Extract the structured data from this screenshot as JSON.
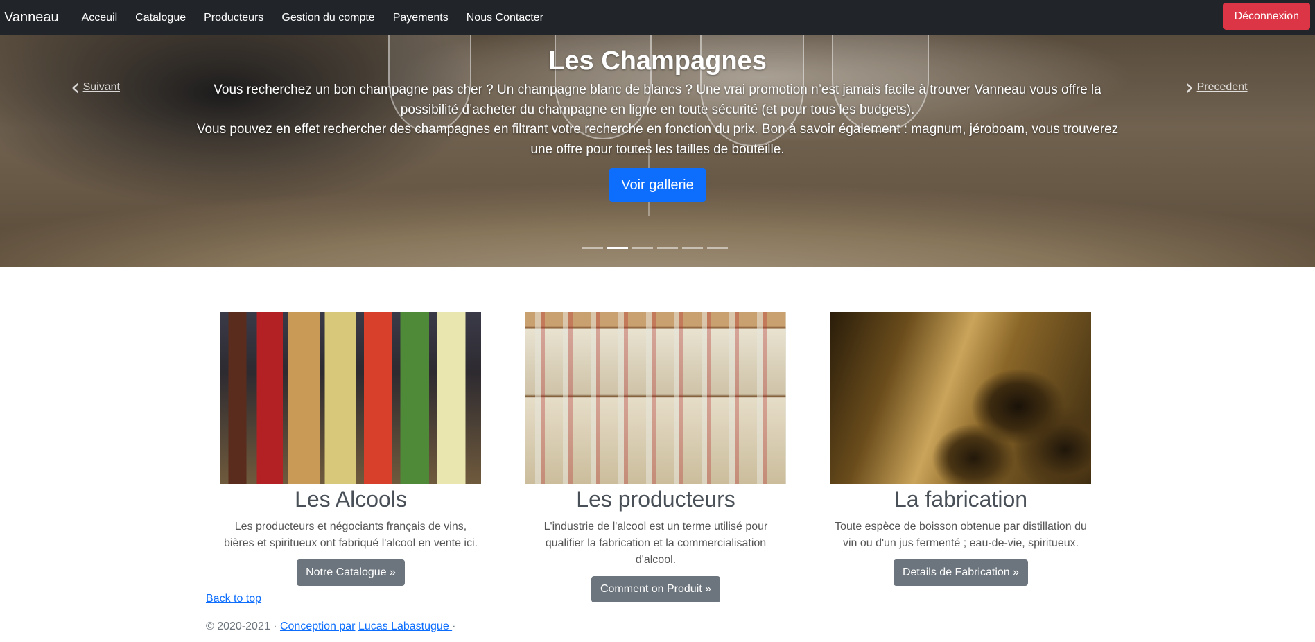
{
  "navbar": {
    "brand": "Vanneau",
    "links": [
      "Acceuil",
      "Catalogue",
      "Producteurs",
      "Gestion du compte",
      "Payements",
      "Nous Contacter"
    ],
    "logout": "Déconnexion"
  },
  "hero": {
    "title": "Les Champagnes",
    "paragraph1": "Vous recherchez un bon champagne pas cher ? Un champagne blanc de blancs ? Une vrai promotion n’est jamais facile à trouver Vanneau vous offre la possibilité d’acheter du champagne en ligne en toute sécurité (et pour tous les budgets).",
    "paragraph2": "Vous pouvez en effet rechercher des champagnes en filtrant votre recherche en fonction du prix. Bon à savoir également : magnum, jéroboam, vous trouverez une offre pour toutes les tailles de bouteille.",
    "button": "Voir gallerie",
    "prev_label": "Suivant",
    "next_label": "Precedent",
    "slide_count": 6,
    "active_slide": 2
  },
  "columns": [
    {
      "title": "Les Alcools",
      "text": "Les producteurs et négociants français de vins, bières et spiritueux ont fabriqué l'alcool en vente ici.",
      "button": "Notre Catalogue »"
    },
    {
      "title": "Les producteurs",
      "text": "L'industrie de l'alcool est un terme utilisé pour qualifier la fabrication et la commercialisation d'alcool.",
      "button": "Comment on Produit »"
    },
    {
      "title": "La fabrication",
      "text": "Toute espèce de boisson obtenue par distillation du vin ou d'un jus fermenté ; eau-de-vie, spiritueux.",
      "button": "Details de Fabrication »"
    }
  ],
  "footer": {
    "back_to_top": "Back to top",
    "copyright": "© 2020-2021 · ",
    "link1": "Conception par",
    "link2": "Lucas Labastugue ",
    "trailing": "·"
  },
  "colors": {
    "navbar_bg": "#212529",
    "danger": "#dc3545",
    "primary": "#0d6efd",
    "secondary": "#6c757d"
  }
}
